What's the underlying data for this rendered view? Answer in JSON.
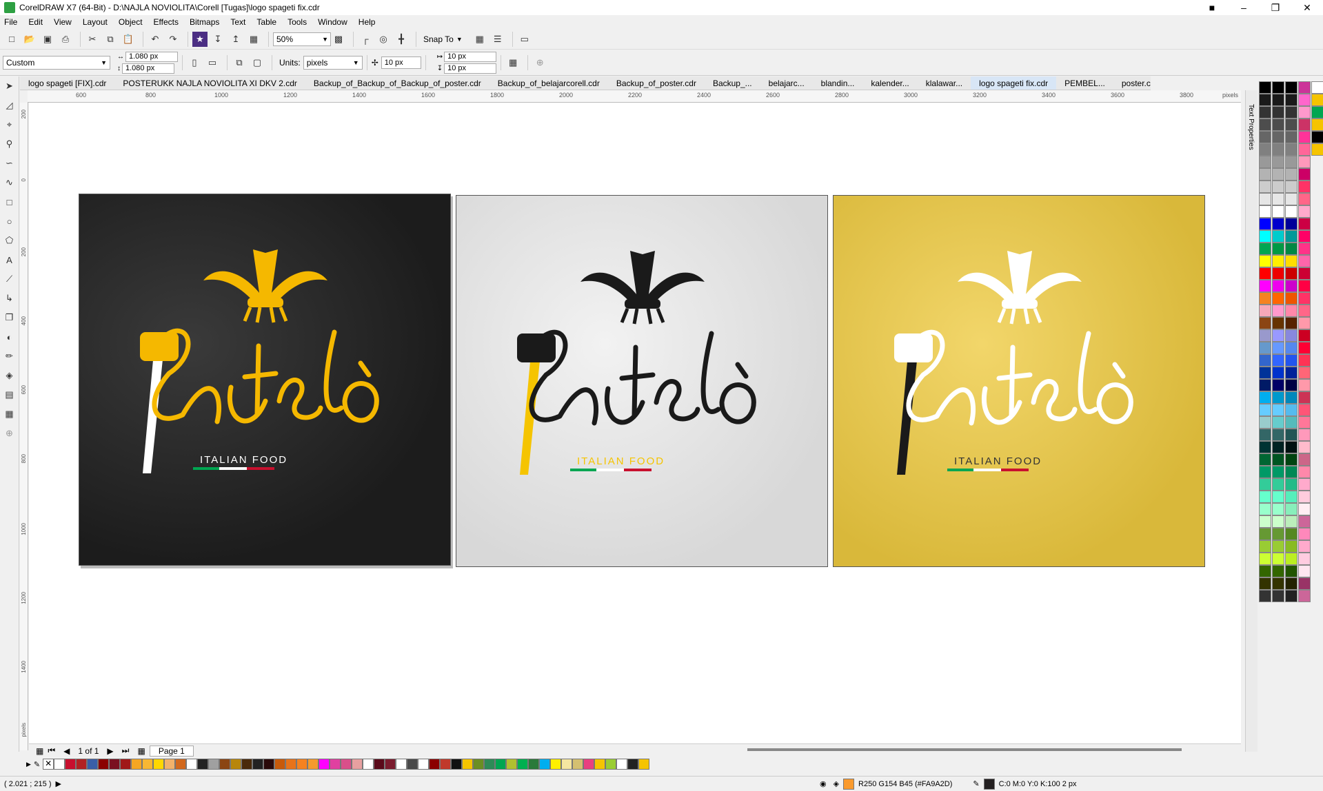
{
  "window": {
    "title": "CorelDRAW X7 (64-Bit) - D:\\NAJLA NOVIOLITA\\Corell [Tugas]\\logo spageti fix.cdr"
  },
  "menu": [
    "File",
    "Edit",
    "View",
    "Layout",
    "Object",
    "Effects",
    "Bitmaps",
    "Text",
    "Table",
    "Tools",
    "Window",
    "Help"
  ],
  "toolbar": {
    "zoom": "50%",
    "snap_to": "Snap To"
  },
  "propertybar": {
    "preset": "Custom",
    "width": "1.080 px",
    "height": "1.080 px",
    "units_label": "Units:",
    "units": "pixels",
    "nudge": "10 px",
    "dup_x": "10 px",
    "dup_y": "10 px"
  },
  "tabs": [
    "logo spageti [FIX].cdr",
    "POSTERUKK NAJLA NOVIOLITA XI DKV 2.cdr",
    "Backup_of_Backup_of_Backup_of_poster.cdr",
    "Backup_of_belajarcorell.cdr",
    "Backup_of_poster.cdr",
    "Backup_...",
    "belajarc...",
    "blandin...",
    "kalender...",
    "klalawar...",
    "logo spageti fix.cdr",
    "PEMBEL...",
    "poster.cdr"
  ],
  "ruler_h": [
    "600",
    "800",
    "1000",
    "1200",
    "1400",
    "1600",
    "1800",
    "2000",
    "2200",
    "2400",
    "2600",
    "2800",
    "3000",
    "3200",
    "3400",
    "3600",
    "3800",
    "pixels"
  ],
  "ruler_v": [
    "200",
    "0",
    "200",
    "400",
    "600",
    "800",
    "1000",
    "1200",
    "1400",
    "pixels"
  ],
  "artwork": {
    "wordmark": "Pastelo",
    "tagline": "ITALIAN FOOD",
    "panels": [
      {
        "bg": "#222222",
        "fg": "#f5b800",
        "fork": "#ffffff",
        "tag": "#ffffff"
      },
      {
        "bg": "#e3e3e3",
        "fg": "#1a1a1a",
        "fork": "#f5c400",
        "tag": "#f5c400"
      },
      {
        "bg": "#e8c447",
        "fg": "#ffffff",
        "fork": "#1a1a1a",
        "tag": "#333333"
      }
    ]
  },
  "pagebar": {
    "page_of": "1 of 1",
    "page_tab": "Page 1"
  },
  "dock_label": "Text Properties",
  "status": {
    "coords": "( 2.021 ; 215 )",
    "fill_label": "R250 G154 B45 (#FA9A2D)",
    "fill_color": "#FA9A2D",
    "outline_label": "C:0 M:0 Y:0 K:100  2 px"
  },
  "palette_h": [
    "#ffffff",
    "#c8102e",
    "#b22222",
    "#3a5fa8",
    "#8b0000",
    "#7a1020",
    "#a01818",
    "#f5a623",
    "#f7b733",
    "#ffd700",
    "#f2b26b",
    "#d2691e",
    "#ffffff",
    "#222222",
    "#a0a0a0",
    "#8b4513",
    "#b8860b",
    "#4a2a0a",
    "#222222",
    "#2a0a0a",
    "#c85a0a",
    "#e8731a",
    "#f58220",
    "#f59a2d",
    "#ff00ff",
    "#e040a0",
    "#d94f8a",
    "#e8a0a0",
    "#ffffff",
    "#5a0a1a",
    "#7b1c2e",
    "#ffffff",
    "#4a4a4a",
    "#ffffff",
    "#8b0000",
    "#c0392b",
    "#111111",
    "#f5c400",
    "#6b8e23",
    "#2e8b57",
    "#00a651",
    "#b0c030",
    "#00b050",
    "#2a7a3a",
    "#00aeef",
    "#ffef00",
    "#f5e6a0",
    "#d4c070",
    "#e94080",
    "#f5c400",
    "#9acd32",
    "#ffffff",
    "#222222",
    "#f5c400"
  ],
  "palette_v": [
    [
      "#000000",
      "#1a1a1a",
      "#333333",
      "#4d4d4d",
      "#666666",
      "#808080",
      "#999999",
      "#b3b3b3",
      "#cccccc",
      "#e6e6e6",
      "#ffffff",
      "#0000ff",
      "#00ffff",
      "#00a651",
      "#ffff00",
      "#ff0000",
      "#ff00ff",
      "#f58220",
      "#f7a8b8",
      "#8b4513",
      "#9999cc",
      "#6699cc",
      "#3366cc",
      "#003399",
      "#001a66",
      "#00aeef",
      "#66ccff",
      "#99cccc",
      "#336666",
      "#003333",
      "#006633",
      "#009966",
      "#33cc99",
      "#66ffcc",
      "#99ffcc",
      "#ccffcc",
      "#669933",
      "#99cc33",
      "#ccff33",
      "#336600",
      "#333300",
      "#333333"
    ],
    [
      "#000000",
      "#1a1a1a",
      "#333333",
      "#4d4d4d",
      "#666666",
      "#808080",
      "#999999",
      "#b3b3b3",
      "#cccccc",
      "#e6e6e6",
      "#ffffff",
      "#0000cc",
      "#00cccc",
      "#009944",
      "#ffee00",
      "#ee0000",
      "#ee00ee",
      "#ff6600",
      "#ff99cc",
      "#663300",
      "#9999ff",
      "#6699ff",
      "#3366ff",
      "#0033cc",
      "#000066",
      "#0099cc",
      "#66ccff",
      "#66cccc",
      "#336666",
      "#002222",
      "#005522",
      "#009966",
      "#33cc99",
      "#66ffcc",
      "#99ffcc",
      "#ccffcc",
      "#669933",
      "#99cc33",
      "#ccff33",
      "#336600",
      "#333300",
      "#333333"
    ],
    [
      "#000000",
      "#1a1a1a",
      "#333333",
      "#4d4d4d",
      "#666666",
      "#808080",
      "#999999",
      "#b3b3b3",
      "#cccccc",
      "#e6e6e6",
      "#ffffff",
      "#000099",
      "#009999",
      "#008844",
      "#ffdd00",
      "#cc0000",
      "#cc00cc",
      "#ee5500",
      "#ff88aa",
      "#552200",
      "#8888dd",
      "#5588ee",
      "#2255ee",
      "#002299",
      "#000044",
      "#0088bb",
      "#55bbee",
      "#55bbbb",
      "#225555",
      "#001111",
      "#004411",
      "#008855",
      "#22bb88",
      "#55eebb",
      "#88eebb",
      "#bbeebb",
      "#558822",
      "#88bb22",
      "#bbee22",
      "#225500",
      "#222200",
      "#222222"
    ],
    [
      "#cc3399",
      "#ff66cc",
      "#ff99cc",
      "#cc3366",
      "#ff3399",
      "#ff6699",
      "#ff99bb",
      "#cc0066",
      "#ff3366",
      "#ff6688",
      "#ffaacc",
      "#cc0044",
      "#ff0066",
      "#ff3388",
      "#ff66aa",
      "#cc0033",
      "#ff0044",
      "#ff3366",
      "#ff6688",
      "#ff99aa",
      "#cc0022",
      "#ff0033",
      "#ff3355",
      "#ff6677",
      "#ff99aa",
      "#cc3355",
      "#ff5577",
      "#ff7799",
      "#ff99bb",
      "#ffbbcc",
      "#cc6688",
      "#ff88aa",
      "#ffaacc",
      "#ffccdd",
      "#ffeef3",
      "#cc6699",
      "#ff88bb",
      "#ffaacc",
      "#ffcce0",
      "#ffe6f0",
      "#993366",
      "#cc6699"
    ],
    [
      "#ffffff",
      "#f5c400",
      "#00a651",
      "#f5c400",
      "#000000",
      "#f5c400"
    ]
  ]
}
